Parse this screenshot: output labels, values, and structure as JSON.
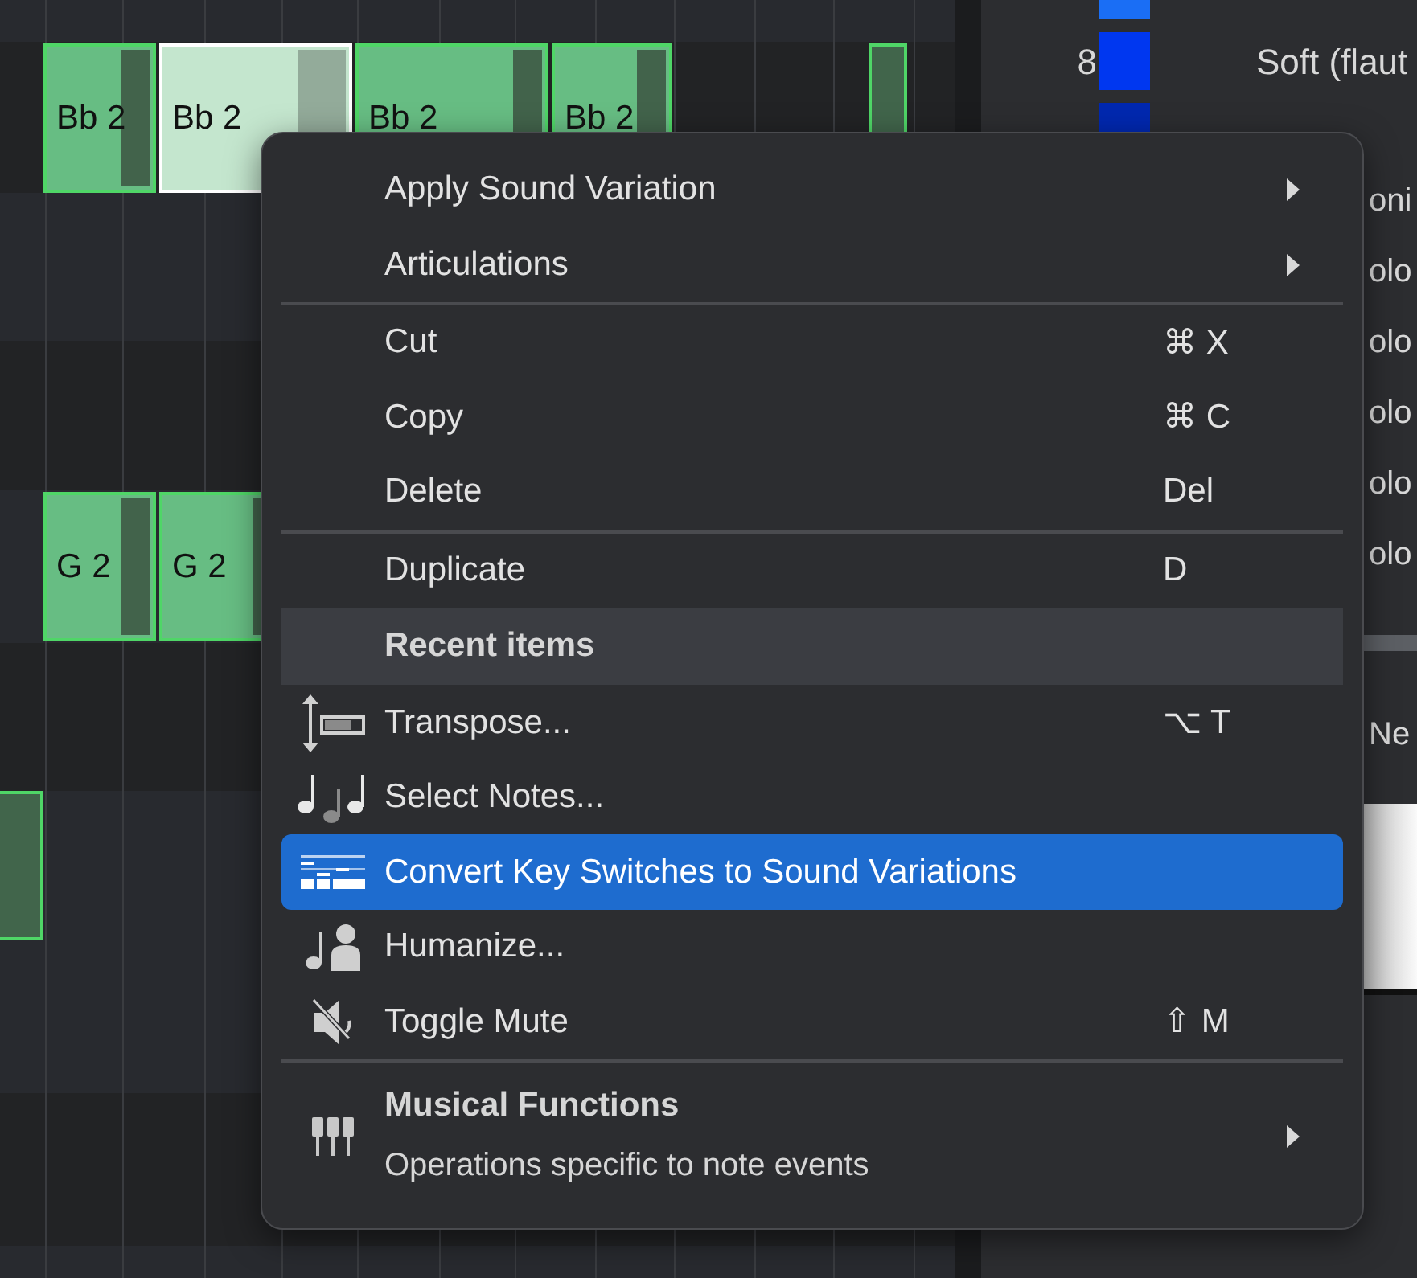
{
  "piano_roll": {
    "notes": [
      {
        "label": "Bb 2",
        "selected": false
      },
      {
        "label": "Bb 2",
        "selected": true
      },
      {
        "label": "Bb 2",
        "selected": false
      },
      {
        "label": "Bb 2",
        "selected": false
      },
      {
        "selected": false
      },
      {
        "label": "G 2",
        "selected": false
      },
      {
        "label": "G 2",
        "selected": false
      },
      {
        "selected": false
      }
    ]
  },
  "sound_variations": {
    "rows": [
      {
        "kind": "swatch",
        "color": "#1a6ef5"
      },
      {
        "kind": "full",
        "number": "8",
        "color": "#0037f0",
        "name": "Soft (flaut"
      },
      {
        "kind": "swatch",
        "color": "#0028b0"
      },
      {
        "kind": "clipped",
        "name": "oni"
      },
      {
        "kind": "clipped",
        "name": "olo"
      },
      {
        "kind": "clipped",
        "name": "olo"
      },
      {
        "kind": "clipped",
        "name": "olo"
      },
      {
        "kind": "clipped",
        "name": "olo"
      },
      {
        "kind": "clipped",
        "name": "olo"
      }
    ],
    "new_label": "Ne"
  },
  "context_menu": {
    "items": [
      {
        "kind": "submenu",
        "label": "Apply Sound Variation",
        "selected": false
      },
      {
        "kind": "submenu",
        "label": "Articulations",
        "selected": false
      },
      {
        "kind": "separator"
      },
      {
        "kind": "command",
        "label": "Cut",
        "shortcut": "⌘ X",
        "selected": false
      },
      {
        "kind": "command",
        "label": "Copy",
        "shortcut": "⌘ C",
        "selected": false
      },
      {
        "kind": "command",
        "label": "Delete",
        "shortcut": "Del",
        "selected": false
      },
      {
        "kind": "separator"
      },
      {
        "kind": "command",
        "label": "Duplicate",
        "shortcut": "D",
        "selected": false
      },
      {
        "kind": "header",
        "label": "Recent items"
      },
      {
        "kind": "command",
        "label": "Transpose...",
        "shortcut": "⌥ T",
        "selected": false
      },
      {
        "kind": "command",
        "label": "Select Notes...",
        "selected": false
      },
      {
        "kind": "command",
        "label": "Convert Key Switches to Sound Variations",
        "selected": true
      },
      {
        "kind": "command",
        "label": "Humanize...",
        "selected": false
      },
      {
        "kind": "command",
        "label": "Toggle Mute",
        "shortcut": "⇧ M",
        "selected": false
      },
      {
        "kind": "separator"
      },
      {
        "kind": "group",
        "label": "Musical Functions",
        "description": "Operations specific to note events",
        "selected": false
      }
    ]
  }
}
